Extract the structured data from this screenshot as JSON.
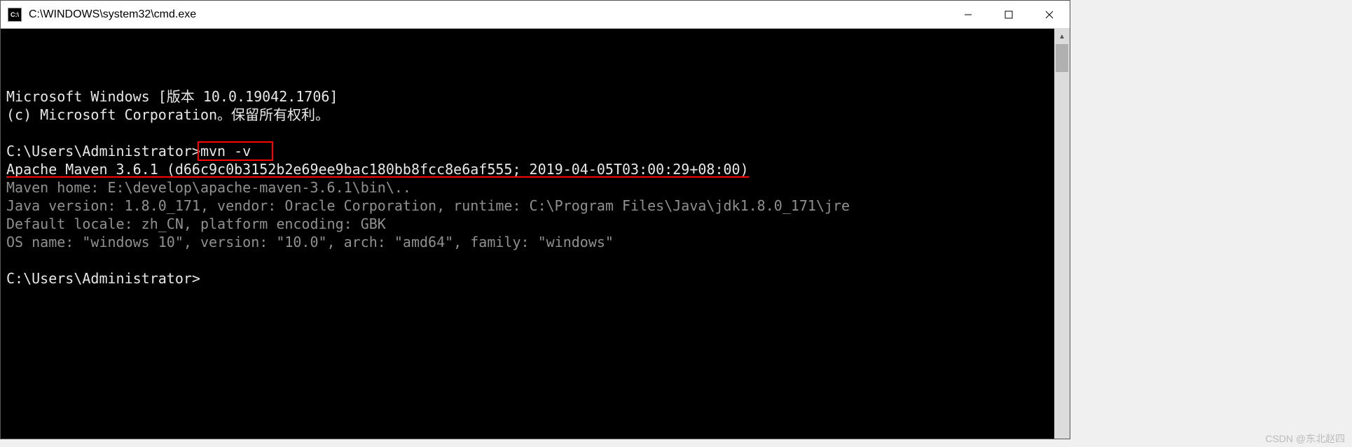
{
  "titlebar": {
    "icon_label": "C:\\",
    "title": "C:\\WINDOWS\\system32\\cmd.exe"
  },
  "terminal": {
    "line1": "Microsoft Windows [版本 10.0.19042.1706]",
    "line2": "(c) Microsoft Corporation。保留所有权利。",
    "prompt1_prefix": "C:\\Users\\Administrator>",
    "command": "mvn -v",
    "maven_line": "Apache Maven 3.6.1 (d66c9c0b3152b2e69ee9bac180bb8fcc8e6af555; 2019-04-05T03:00:29+08:00)",
    "maven_home": "Maven home: E:\\develop\\apache-maven-3.6.1\\bin\\..",
    "java_version": "Java version: 1.8.0_171, vendor: Oracle Corporation, runtime: C:\\Program Files\\Java\\jdk1.8.0_171\\jre",
    "default_locale": "Default locale: zh_CN, platform encoding: GBK",
    "os_name": "OS name: \"windows 10\", version: \"10.0\", arch: \"amd64\", family: \"windows\"",
    "prompt2": "C:\\Users\\Administrator>"
  },
  "watermark": "CSDN @东北赵四"
}
